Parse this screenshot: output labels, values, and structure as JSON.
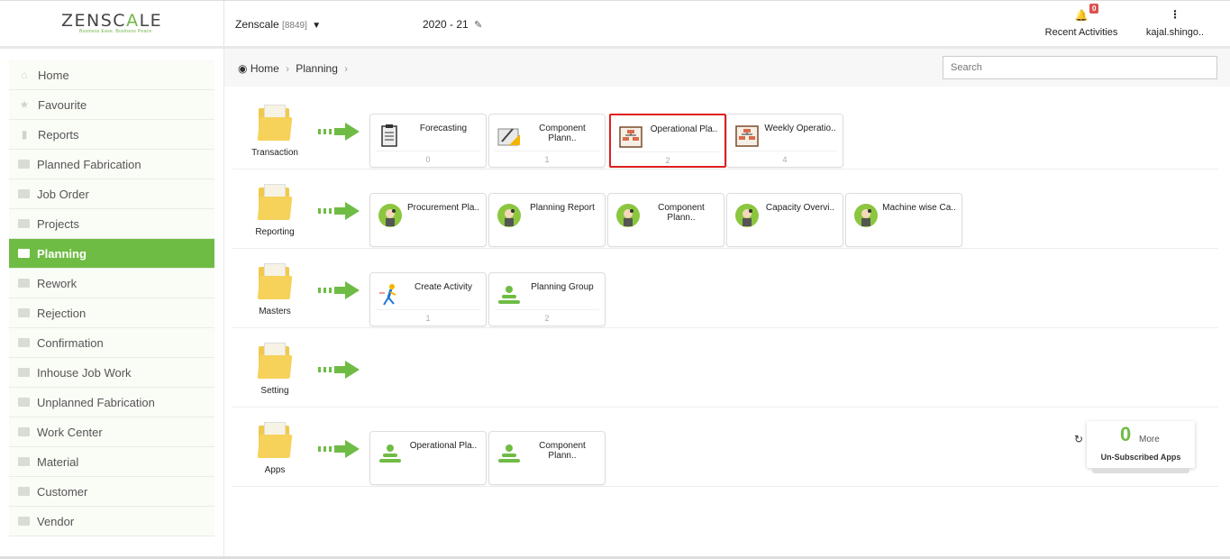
{
  "header": {
    "logo": {
      "pre": "ZENSC",
      "accent": "A",
      "post": "LE",
      "tagline": "Business Ease. Business Peace."
    },
    "company": {
      "name": "Zenscale",
      "code": "[8849]"
    },
    "year": "2020 - 21",
    "recent": {
      "label": "Recent Activities",
      "count": "0"
    },
    "user": {
      "label": "kajal.shingo.."
    }
  },
  "sidebar": {
    "items": [
      {
        "label": "Home",
        "icon": "home-icon"
      },
      {
        "label": "Favourite",
        "icon": "star-icon"
      },
      {
        "label": "Reports",
        "icon": "document-icon"
      },
      {
        "label": "Planned Fabrication",
        "icon": "folder-icon"
      },
      {
        "label": "Job Order",
        "icon": "folder-icon"
      },
      {
        "label": "Projects",
        "icon": "folder-icon"
      },
      {
        "label": "Planning",
        "icon": "folder-icon",
        "active": true
      },
      {
        "label": "Rework",
        "icon": "folder-icon"
      },
      {
        "label": "Rejection",
        "icon": "folder-icon"
      },
      {
        "label": "Confirmation",
        "icon": "folder-icon"
      },
      {
        "label": "Inhouse Job Work",
        "icon": "folder-icon"
      },
      {
        "label": "Unplanned Fabrication",
        "icon": "folder-icon"
      },
      {
        "label": "Work Center",
        "icon": "folder-icon"
      },
      {
        "label": "Material",
        "icon": "folder-icon"
      },
      {
        "label": "Customer",
        "icon": "folder-icon"
      },
      {
        "label": "Vendor",
        "icon": "folder-icon"
      }
    ]
  },
  "breadcrumb": {
    "home": "Home",
    "current": "Planning"
  },
  "search": {
    "placeholder": "Search"
  },
  "sections": [
    {
      "name": "Transaction",
      "tiles": [
        {
          "title": "Forecasting",
          "count": "0",
          "icon": "clipboard-icon"
        },
        {
          "title": "Component Plann..",
          "count": "1",
          "icon": "blueprint-icon"
        },
        {
          "title": "Operational Pla..",
          "count": "2",
          "icon": "flowchart-board-icon",
          "selected": true
        },
        {
          "title": "Weekly Operatio..",
          "count": "4",
          "icon": "flowchart-board-icon"
        }
      ]
    },
    {
      "name": "Reporting",
      "tiles": [
        {
          "title": "Procurement Pla..",
          "count": "",
          "icon": "user-avatar-icon"
        },
        {
          "title": "Planning Report",
          "count": "",
          "icon": "user-avatar-icon"
        },
        {
          "title": "Component Plann..",
          "count": "",
          "icon": "user-avatar-icon"
        },
        {
          "title": "Capacity Overvi..",
          "count": "",
          "icon": "user-avatar-icon"
        },
        {
          "title": "Machine wise Ca..",
          "count": "",
          "icon": "user-avatar-icon"
        }
      ]
    },
    {
      "name": "Masters",
      "tiles": [
        {
          "title": "Create Activity",
          "count": "1",
          "icon": "runner-icon"
        },
        {
          "title": "Planning Group",
          "count": "2",
          "icon": "group-icon"
        }
      ]
    },
    {
      "name": "Setting",
      "tiles": []
    },
    {
      "name": "Apps",
      "tiles": [
        {
          "title": "Operational Pla..",
          "count": "",
          "icon": "group-icon"
        },
        {
          "title": "Component Plann..",
          "count": "",
          "icon": "group-icon"
        }
      ]
    }
  ],
  "more_apps": {
    "count": "0",
    "word": "More",
    "label": "Un-Subscribed Apps"
  },
  "colors": {
    "accent": "#6fbc45",
    "selected_border": "#e02020",
    "badge": "#d9534f"
  }
}
